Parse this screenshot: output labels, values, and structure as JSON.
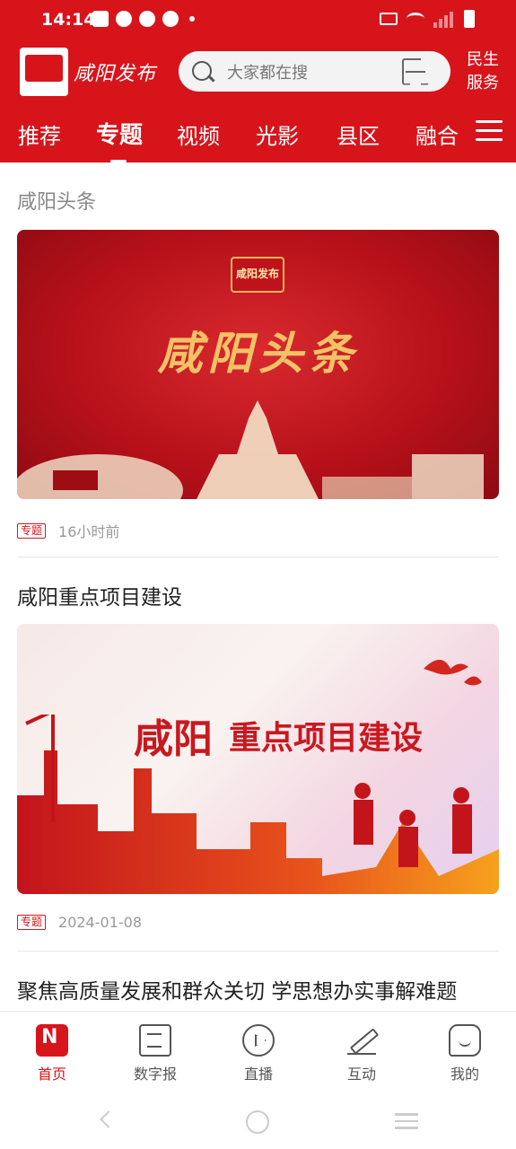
{
  "status_bar": {
    "time": "14:14"
  },
  "header": {
    "logo_text": "咸阳发布",
    "search": {
      "placeholder": "大家都在搜"
    },
    "service_label_line1": "民生",
    "service_label_line2": "服务"
  },
  "tabs": [
    {
      "label": "推荐"
    },
    {
      "label": "专题",
      "active": true
    },
    {
      "label": "视频"
    },
    {
      "label": "光影"
    },
    {
      "label": "县区"
    },
    {
      "label": "融合"
    }
  ],
  "feed": {
    "section_title": "咸阳头条",
    "items": [
      {
        "banner_badge": "咸阳发布",
        "banner_title": "咸阳头条",
        "tag": "专题",
        "time": "16小时前"
      },
      {
        "title": "咸阳重点项目建设",
        "banner_title_a": "咸阳",
        "banner_title_b": "重点项目建设",
        "tag": "专题",
        "time": "2024-01-08"
      },
      {
        "title": "聚焦高质量发展和群众关切 学思想办实事解难题"
      }
    ]
  },
  "bottom_nav": [
    {
      "label": "首页",
      "icon": "home-icon",
      "active": true
    },
    {
      "label": "数字报",
      "icon": "newspaper-icon"
    },
    {
      "label": "直播",
      "icon": "live-play-icon"
    },
    {
      "label": "互动",
      "icon": "pen-icon"
    },
    {
      "label": "我的",
      "icon": "profile-icon"
    }
  ],
  "colors": {
    "brand_red": "#d8141b",
    "gold": "#f2c266"
  }
}
